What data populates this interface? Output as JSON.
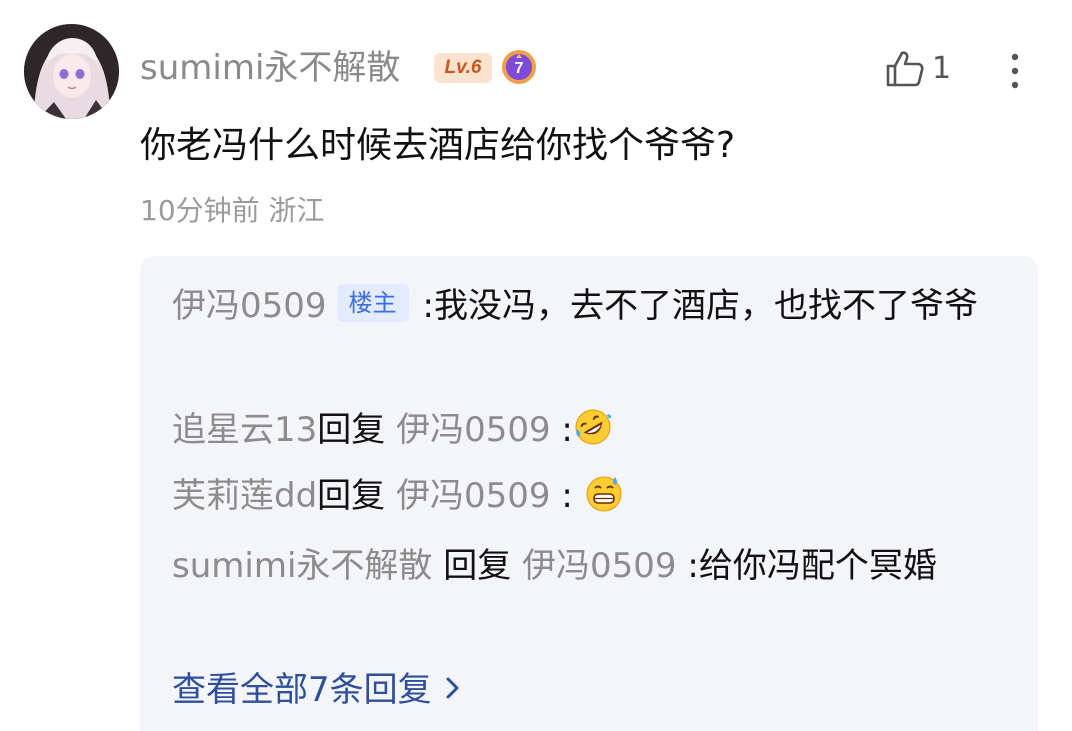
{
  "comment": {
    "username": "sumimi永不解散",
    "level_badge": "Lv.6",
    "medal_number": "7",
    "like_count": "1",
    "text": "你老冯什么时候去酒店给你找个爷爷?",
    "time": "10分钟前",
    "location": "浙江",
    "icons": {
      "avatar": "anime-girl-avatar",
      "like": "thumbs-up-icon",
      "more": "vertical-ellipsis-icon",
      "medal": "purple-medal-icon"
    }
  },
  "replies": [
    {
      "author": "伊冯0509",
      "tag": "楼主",
      "separator": ":",
      "text": "我没冯，去不了酒店，也找不了爷爷"
    },
    {
      "author": "追星云13",
      "verb": "回复",
      "target": "伊冯0509",
      "separator": ":",
      "emoji": "rolling-on-floor-laughing"
    },
    {
      "author": "芙莉莲dd",
      "verb": "回复",
      "target": "伊冯0509",
      "separator": ":",
      "emoji": "grinning-sweat"
    },
    {
      "author": "sumimi永不解散",
      "verb": "回复",
      "target": "伊冯0509",
      "separator": ":",
      "text": "给你冯配个冥婚"
    }
  ],
  "view_all": {
    "label": "查看全部7条回复"
  },
  "colors": {
    "reply_box_bg": "#f4f5f8",
    "name_gray": "#8c8c8c",
    "link_blue": "#2f4f9a",
    "host_tag_bg": "#e2ebff",
    "host_tag_text": "#3d6ee0",
    "level_badge_bg": "#fbe3cf",
    "level_badge_text": "#c8571c"
  }
}
